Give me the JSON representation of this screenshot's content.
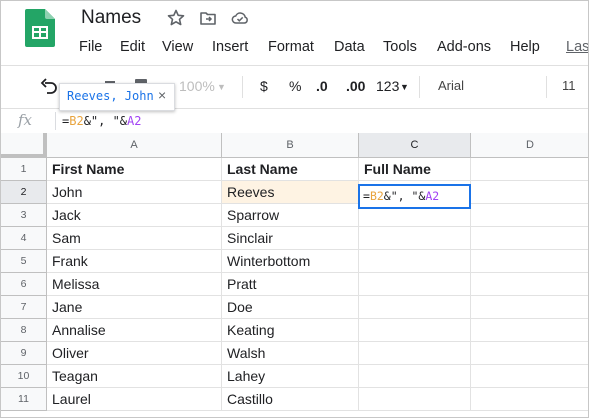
{
  "app": {
    "title": "Names",
    "icons": {
      "logo": "google-sheets-logo",
      "star": "star-icon",
      "move": "move-to-folder-icon",
      "cloud": "cloud-saved-icon"
    }
  },
  "menu": [
    "File",
    "Edit",
    "View",
    "Insert",
    "Format",
    "Data",
    "Tools",
    "Add-ons",
    "Help",
    "Las"
  ],
  "toolbar": {
    "zoom": "100%",
    "currency": "$",
    "percent": "%",
    "decrease_decimal": ".0",
    "increase_decimal": ".00",
    "more_formats": "123",
    "font": "Arial",
    "font_size": "11"
  },
  "suggestion": {
    "text": "Reeves, John",
    "close": "×"
  },
  "formula_bar": {
    "fx": "fx",
    "formula_prefix": "=",
    "ref1": "B2",
    "middle": "&\", \"&",
    "ref2": "A2"
  },
  "grid": {
    "columns": [
      "A",
      "B",
      "C",
      "D"
    ],
    "rows": [
      "1",
      "2",
      "3",
      "4",
      "5",
      "6",
      "7",
      "8",
      "9",
      "10",
      "11"
    ],
    "headers": {
      "A": "First Name",
      "B": "Last Name",
      "C": "Full Name"
    },
    "data": [
      [
        "John",
        "Reeves"
      ],
      [
        "Jack",
        "Sparrow"
      ],
      [
        "Sam",
        "Sinclair"
      ],
      [
        "Frank",
        "Winterbottom"
      ],
      [
        "Melissa",
        "Pratt"
      ],
      [
        "Jane",
        "Doe"
      ],
      [
        "Annalise",
        "Keating"
      ],
      [
        "Oliver",
        "Walsh"
      ],
      [
        "Teagan",
        "Lahey"
      ],
      [
        "Laurel",
        "Castillo"
      ]
    ],
    "active_cell": {
      "prefix": "=",
      "ref1": "B2",
      "middle": "&\", \"&",
      "ref2": "A2"
    }
  }
}
